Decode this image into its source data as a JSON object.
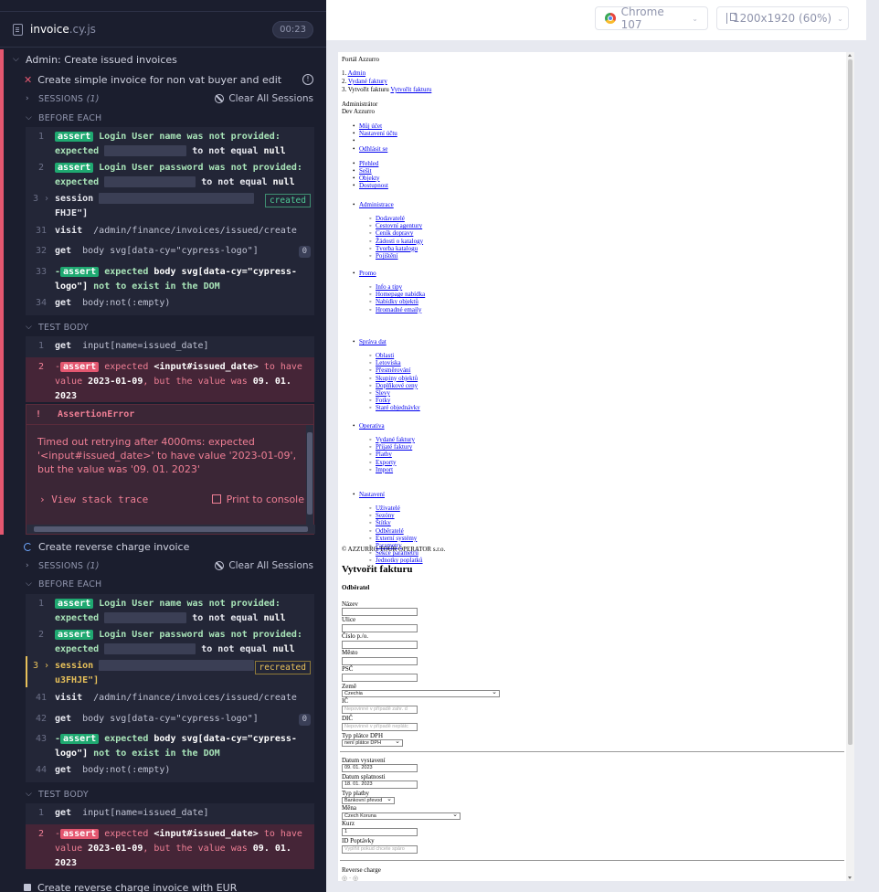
{
  "reporter": {
    "spec": {
      "name": "invoice",
      "ext": ".cy.js",
      "duration": "00:23"
    },
    "suite_title": "Admin: Create issued invoices",
    "test1": {
      "title": "Create simple invoice for non vat buyer and edit",
      "sessions_label": "SESSIONS",
      "sessions_count": "(1)",
      "clear_sessions": "Clear All Sessions",
      "before_each": "BEFORE EACH",
      "test_body": "TEST BODY",
      "commands": [
        {
          "num": "1",
          "badge": "assert",
          "msg": "Login User name was not provided:",
          "line2a": "expected",
          "line2b": "to not equal",
          "line2c": "null"
        },
        {
          "num": "2",
          "badge": "assert",
          "msg": "Login User password was not provided:",
          "line2a": "expected",
          "line2b": "to not equal",
          "line2c": "null"
        },
        {
          "num": "3",
          "name": "session",
          "line2": "FHJE\"]",
          "tag": "created"
        },
        {
          "num": "31",
          "name": "visit",
          "arg": "/admin/finance/invoices/issued/create"
        },
        {
          "num": "32",
          "name": "get",
          "arg": "body svg[data-cy=\"cypress-logo\"]",
          "count": "0"
        },
        {
          "num": "33",
          "badge": "assert",
          "prefix": "-",
          "msg": "expected",
          "arg": "body svg[data-cy=\"cypress-",
          "line2": "logo\"]",
          "tail": "not to exist in the DOM"
        },
        {
          "num": "34",
          "name": "get",
          "arg": "body:not(:empty)"
        }
      ],
      "body_commands": [
        {
          "num": "1",
          "name": "get",
          "arg": "input[name=issued_date]"
        },
        {
          "num": "2",
          "prefix": "-",
          "badge": "assert",
          "msg": "expected",
          "sel": "<input#issued_date>",
          "t1": "to have",
          "t2": "value",
          "v1": "2023-01-09",
          "t3": ", but the value was",
          "v2": "09. 01.",
          "v3": "2023"
        }
      ],
      "error": {
        "name": "AssertionError",
        "message": "Timed out retrying after 4000ms: expected '<input#issued_date>' to have value '2023-01-09', but the value was '09. 01. 2023'",
        "stack_link": "View stack trace",
        "print_link": "Print to console"
      }
    },
    "test2": {
      "title": "Create reverse charge invoice",
      "sessions_label": "SESSIONS",
      "sessions_count": "(1)",
      "clear_sessions": "Clear All Sessions",
      "before_each": "BEFORE EACH",
      "test_body": "TEST BODY",
      "commands": [
        {
          "num": "1",
          "badge": "assert",
          "msg": "Login User name was not provided:",
          "line2a": "expected",
          "line2b": "to not equal",
          "line2c": "null"
        },
        {
          "num": "2",
          "badge": "assert",
          "msg": "Login User password was not provided:",
          "line2a": "expected",
          "line2b": "to not equal",
          "line2c": "null"
        },
        {
          "num": "3",
          "name": "session",
          "line2": "u3FHJE\"]",
          "tag": "recreated"
        },
        {
          "num": "41",
          "name": "visit",
          "arg": "/admin/finance/invoices/issued/create"
        },
        {
          "num": "42",
          "name": "get",
          "arg": "body svg[data-cy=\"cypress-logo\"]",
          "count": "0"
        },
        {
          "num": "43",
          "badge": "assert",
          "prefix": "-",
          "msg": "expected",
          "arg": "body svg[data-cy=\"cypress-",
          "line2": "logo\"]",
          "tail": "not to exist in the DOM"
        },
        {
          "num": "44",
          "name": "get",
          "arg": "body:not(:empty)"
        }
      ],
      "body_commands": [
        {
          "num": "1",
          "name": "get",
          "arg": "input[name=issued_date]"
        },
        {
          "num": "2",
          "prefix": "-",
          "badge": "assert",
          "msg": "expected",
          "sel": "<input#issued_date>",
          "t1": "to have",
          "t2": "value",
          "v1": "2023-01-09",
          "t3": ", but the value was",
          "v2": "09. 01.",
          "v3": "2023"
        }
      ]
    },
    "test3": {
      "title": "Create reverse charge invoice with EUR"
    }
  },
  "topbar": {
    "browser": "Chrome 107",
    "viewport": "1200x1920",
    "zoom": "(60%)"
  },
  "aut": {
    "portal": "Portál Azzurro",
    "breadcrumbs": [
      "Admin",
      "Vydané faktury",
      "Vytvořit fakturu"
    ],
    "breadcrumb_current": "Vytvořit fakturu",
    "user_role": "Administrátor",
    "user_name": "Dev Azzurro",
    "top_links": [
      "Můj účet",
      "Nastavení účtu",
      "",
      "Odhlásit se"
    ],
    "main_links": [
      "Přehled",
      "Sešit",
      "Objekty",
      "Dostupnost"
    ],
    "menu": [
      {
        "title": "Administrace",
        "items": [
          "Dodavatelé",
          "Cestovní agentury",
          "Ceník dopravy",
          "Žádosti o katalogy",
          "Tvorba katalogu",
          "Pojištění"
        ]
      },
      {
        "title": "Promo",
        "items": [
          "Info a tipy",
          "Homepage nabídka",
          "Nabídky objektů",
          "Hromadné emaily"
        ]
      },
      {
        "title": "Správa dat",
        "items": [
          "Oblasti",
          "Letoviska",
          "Přesměrování",
          "Skupiny objektů",
          "Doplňkové ceny",
          "Slevy",
          "Fotky",
          "Staré objednávky"
        ]
      },
      {
        "title": "Operativa",
        "items": [
          "Vydané faktury",
          "Přijaté faktury",
          "Platby",
          "Exporty",
          "Import"
        ]
      },
      {
        "title": "Nastavení",
        "items": [
          "Uživatelé",
          "Sezóny",
          "Štítky",
          "Odběratelé",
          "Externí systémy",
          "Parametry",
          "Sekce parametrů",
          "Jednotky poplatků"
        ]
      }
    ],
    "copyright": "© AZZURRO TOUR OPERATOR s.r.o.",
    "form_title": "Vytvořit fakturu",
    "buyer_heading": "Odběratel",
    "fields": {
      "nazev": "Název",
      "ulice": "Ulice",
      "cislo_po": "Číslo p./o.",
      "mesto": "Město",
      "psc": "PSČ",
      "zeme": "Země",
      "zeme_value": "Czechia",
      "ic": "IČ",
      "ic_placeholder": "Nepovinné v případě zahr. d",
      "dic": "DIČ",
      "dic_placeholder": "Nepovinné v případě neplátc",
      "typ_platce": "Typ plátce DPH",
      "typ_platce_value": "není plátce DPH",
      "datum_vystaveni": "Datum vystavení",
      "datum_vystaveni_value": "09. 01. 2023",
      "datum_splatnosti": "Datum splatnosti",
      "datum_splatnosti_value": "18. 01. 2023",
      "typ_platby": "Typ platby",
      "typ_platby_value": "Bankovní převod",
      "mena": "Měna",
      "mena_value": "Czech Koruna",
      "kurz": "Kurz",
      "kurz_value": "1",
      "id_poptavky": "ID Poptávky",
      "id_poptavky_placeholder": "Vyplňit pokud chcete spáro",
      "reverse_charge": "Reverse charge"
    }
  }
}
